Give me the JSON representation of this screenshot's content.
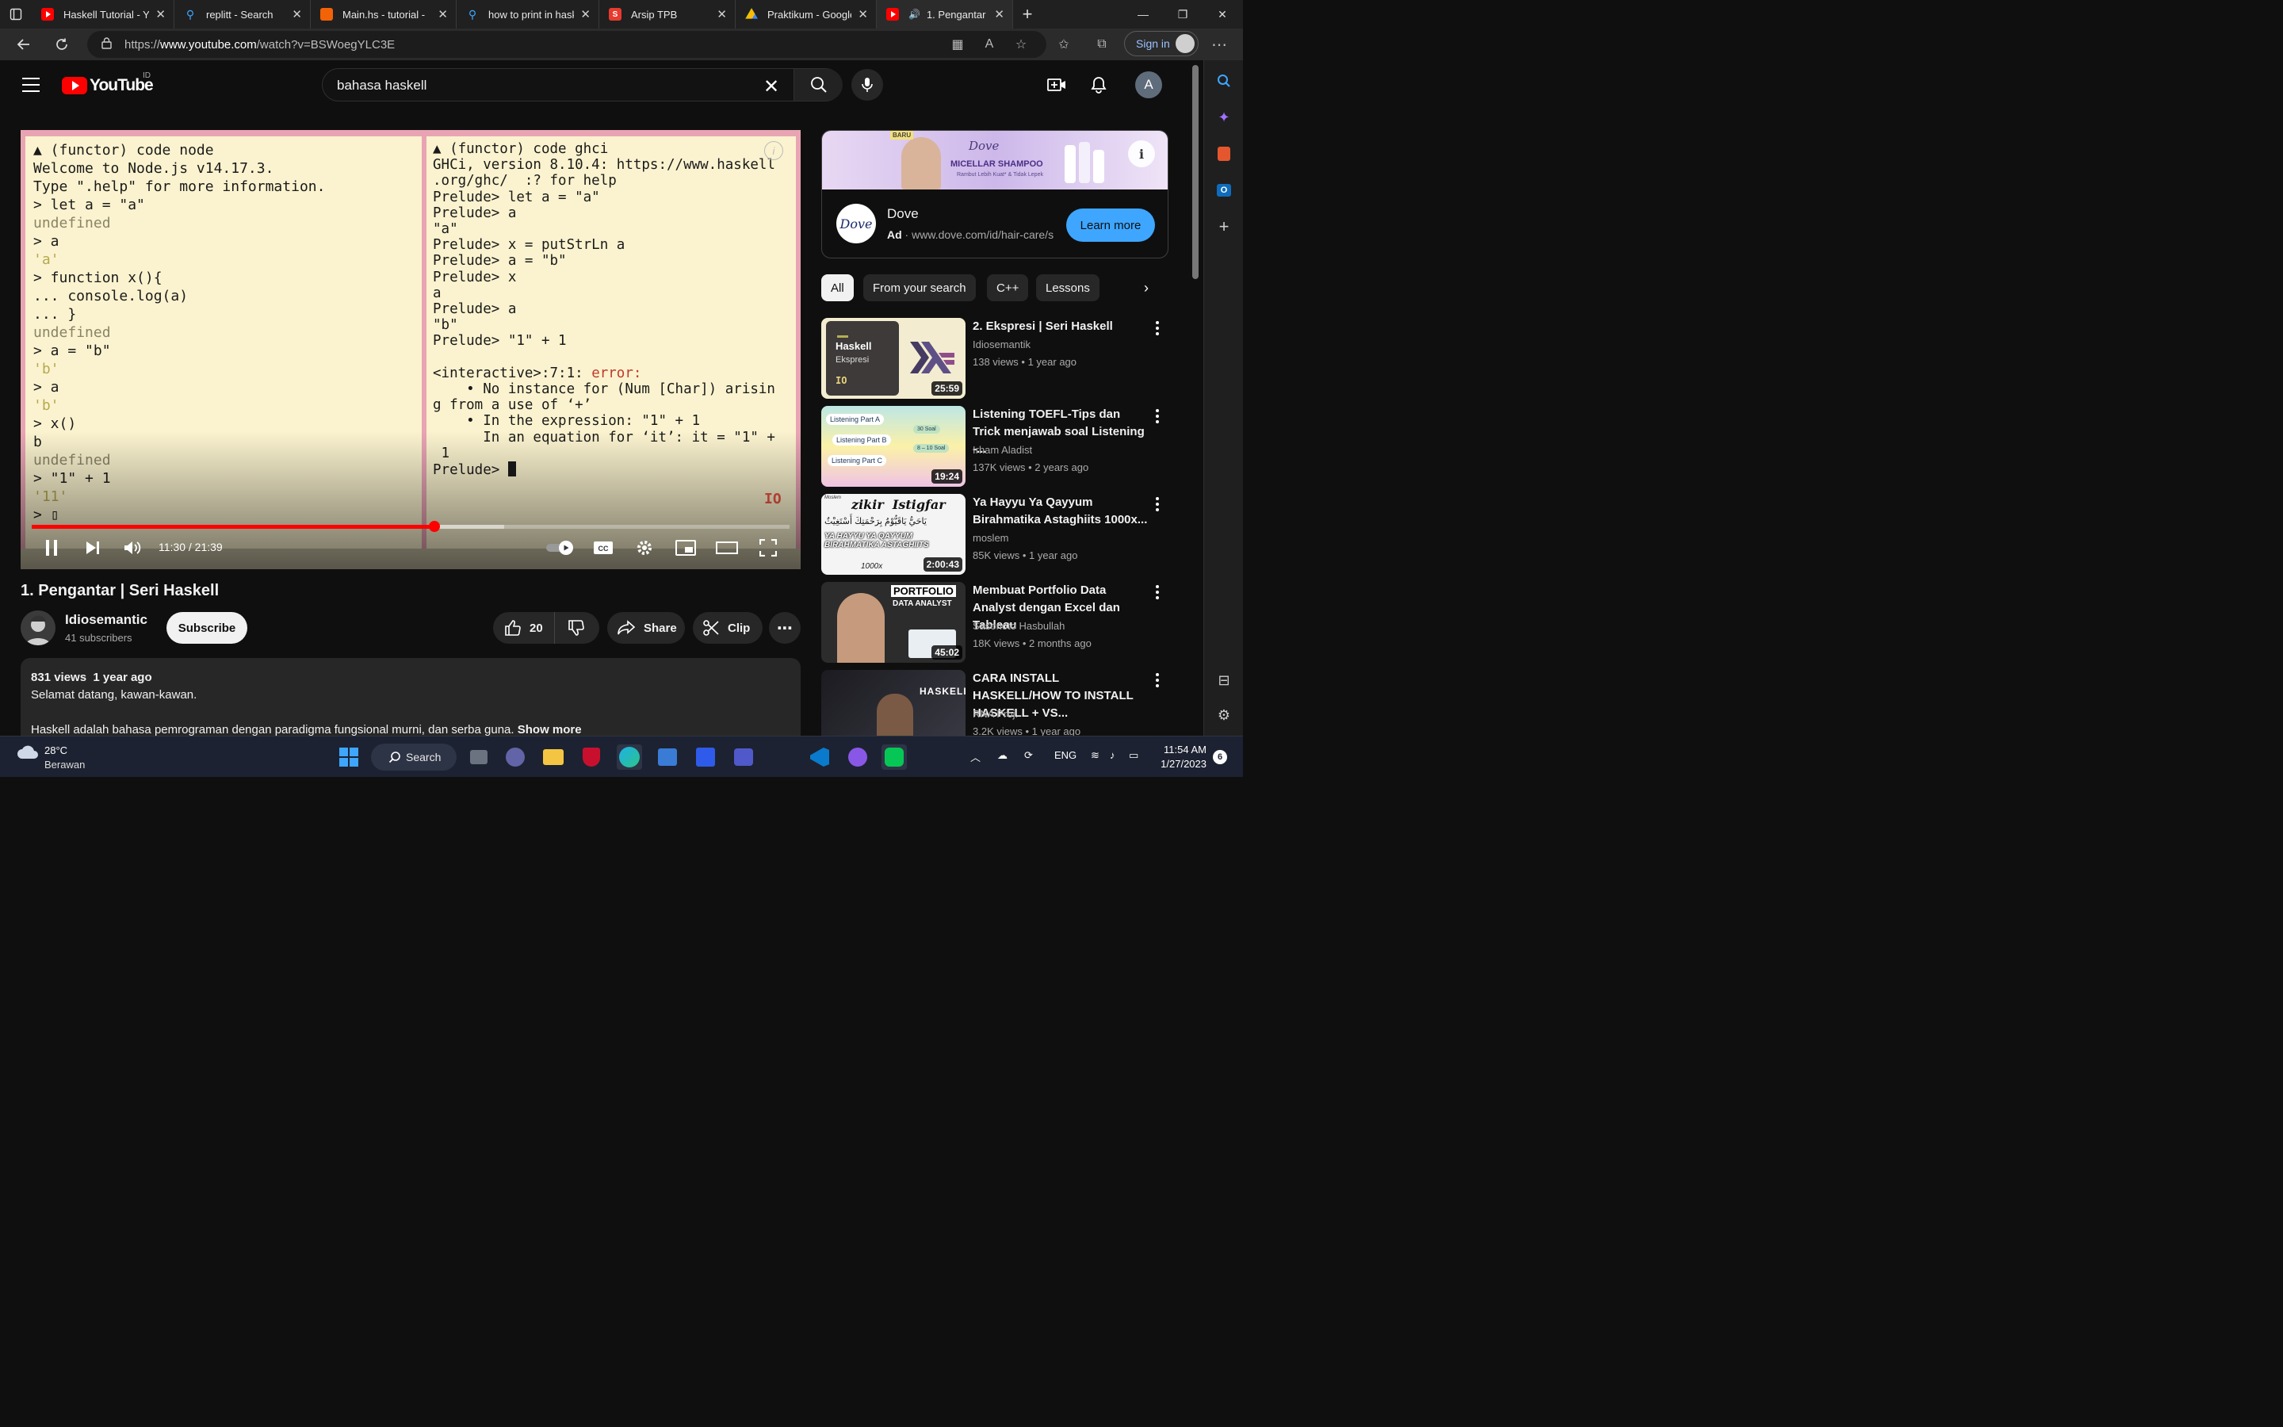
{
  "browser": {
    "tabs": [
      {
        "title": "Haskell Tutorial - Yo",
        "favicon": "youtube-icon",
        "color": "#ff0000"
      },
      {
        "title": "replitt - Search",
        "favicon": "search-icon",
        "color": "#3ea6ff"
      },
      {
        "title": "Main.hs - tutorial - ",
        "favicon": "replit-icon",
        "color": "#f26207"
      },
      {
        "title": "how to print in hask",
        "favicon": "search-icon",
        "color": "#3ea6ff"
      },
      {
        "title": "Arsip TPB",
        "favicon": "s-icon",
        "color": "#e63b2e"
      },
      {
        "title": "Praktikum - Google ",
        "favicon": "google-drive-icon",
        "color": "#fbbc04"
      },
      {
        "title": "1. Pengantar | ",
        "favicon": "youtube-icon",
        "color": "#ff0000",
        "active": true
      }
    ],
    "url_prefix": "https://",
    "url_host": "www.youtube.com",
    "url_path": "/watch?v=BSWoegYLC3E",
    "sign_in": "Sign in"
  },
  "youtube": {
    "logo_text": "YouTube",
    "country": "ID",
    "search_query": "bahasa haskell",
    "account_initial": "A"
  },
  "player": {
    "left_pane_lines": [
      {
        "t": "▲ (functor) code node",
        "c": ""
      },
      {
        "t": "Welcome to Node.js v14.17.3.",
        "c": ""
      },
      {
        "t": "Type \".help\" for more information.",
        "c": ""
      },
      {
        "t": "> let a = \"a\"",
        "c": ""
      },
      {
        "t": "undefined",
        "c": "dim"
      },
      {
        "t": "> a",
        "c": ""
      },
      {
        "t": "'a'",
        "c": "str"
      },
      {
        "t": "> function x(){",
        "c": ""
      },
      {
        "t": "... console.log(a)",
        "c": ""
      },
      {
        "t": "... }",
        "c": ""
      },
      {
        "t": "undefined",
        "c": "dim"
      },
      {
        "t": "> a = \"b\"",
        "c": ""
      },
      {
        "t": "'b'",
        "c": "str"
      },
      {
        "t": "> a",
        "c": ""
      },
      {
        "t": "'b'",
        "c": "str"
      },
      {
        "t": "> x()",
        "c": ""
      },
      {
        "t": "b",
        "c": ""
      },
      {
        "t": "undefined",
        "c": "dim"
      },
      {
        "t": "> \"1\" + 1",
        "c": ""
      },
      {
        "t": "'11'",
        "c": "str"
      },
      {
        "t": "> ▯",
        "c": ""
      }
    ],
    "right_pane_lines": [
      {
        "t": "▲ (functor) code ghci",
        "c": ""
      },
      {
        "t": "GHCi, version 8.10.4: https://www.haskell",
        "c": ""
      },
      {
        "t": ".org/ghc/  :? for help",
        "c": ""
      },
      {
        "t": "Prelude> let a = \"a\"",
        "c": ""
      },
      {
        "t": "Prelude> a",
        "c": ""
      },
      {
        "t": "\"a\"",
        "c": ""
      },
      {
        "t": "Prelude> x = putStrLn a",
        "c": ""
      },
      {
        "t": "Prelude> a = \"b\"",
        "c": ""
      },
      {
        "t": "Prelude> x",
        "c": ""
      },
      {
        "t": "a",
        "c": ""
      },
      {
        "t": "Prelude> a",
        "c": ""
      },
      {
        "t": "\"b\"",
        "c": ""
      },
      {
        "t": "Prelude> \"1\" + 1",
        "c": ""
      },
      {
        "t": "",
        "c": ""
      },
      {
        "t": "<interactive>:7:1: ",
        "c": "",
        "err": "error:"
      },
      {
        "t": "    • No instance for (Num [Char]) arisin",
        "c": ""
      },
      {
        "t": "g from a use of ‘+’",
        "c": ""
      },
      {
        "t": "    • In the expression: \"1\" + 1",
        "c": ""
      },
      {
        "t": "      In an equation for ‘it’: it = \"1\" +",
        "c": ""
      },
      {
        "t": " 1",
        "c": ""
      },
      {
        "t": "Prelude> ",
        "c": "",
        "cursor": true
      }
    ],
    "badge": "IO",
    "time_current": "11:30",
    "time_total": "21:39",
    "time_display": "11:30 / 21:39",
    "played_fraction": 0.531,
    "buffered_fraction": 0.623
  },
  "video": {
    "title": "1. Pengantar | Seri Haskell",
    "channel": "Idiosemantic",
    "subscribers": "41 subscribers",
    "subscribe_label": "Subscribe",
    "likes": "20",
    "share_label": "Share",
    "clip_label": "Clip",
    "views": "831 views",
    "age": "1 year ago",
    "desc_line1": "Selamat datang, kawan-kawan.",
    "desc_line2": "Haskell adalah bahasa pemrograman dengan paradigma fungsional murni, dan serba guna.",
    "show_more": "Show more"
  },
  "ad": {
    "banner_badge": "BARU",
    "banner_brand": "Dove",
    "banner_product": "MICELLAR SHAMPOO",
    "banner_tagline": "Rambut Lebih Kuat* & Tidak Lepek",
    "logo": "Dove",
    "name": "Dove",
    "label": "Ad",
    "url": "www.dove.com/id/hair-care/sha",
    "cta": "Learn more"
  },
  "chips": [
    "All",
    "From your search",
    "C++",
    "Lessons"
  ],
  "recommendations": [
    {
      "title": "2. Ekspresi | Seri Haskell",
      "channel": "Idiosemantik",
      "meta": "138 views • 1 year ago",
      "duration": "25:59",
      "thumb_title": "Haskell",
      "thumb_sub": "Ekspresi",
      "thumb_badge": "IO"
    },
    {
      "title": "Listening TOEFL-Tips dan Trick menjawab soal Listening -...",
      "channel": "Irham Aladist",
      "meta": "137K views • 2 years ago",
      "duration": "19:24",
      "thumb_labels": [
        "Listening Part A",
        "Listening Part B",
        "Listening Part C",
        "30 Soal",
        "8 – 10 Soal"
      ]
    },
    {
      "title": "Ya Hayyu Ya Qayyum Birahmatika Astaghiits 1000x...",
      "channel": "moslem",
      "meta": "85K views • 1 year ago",
      "duration": "2:00:43",
      "thumb_title": "zikir  Istigfar",
      "thumb_sub": "YA HAYYU YA QAYYUM BIRAHMATIKA ASTAGHIITS",
      "thumb_count": "1000x",
      "thumb_arabic": "يَاحَيُّ يَاقَيُّوْمُ بِرَحْمَتِكَ أَسْتَغِيْثُ",
      "thumb_brand": "Moslem"
    },
    {
      "title": "Membuat Portfolio Data Analyst dengan Excel dan Tableau",
      "channel": "Sasonoto Hasbullah",
      "meta": "18K views • 2 months ago",
      "duration": "45:02",
      "thumb_title": "PORTFOLIO",
      "thumb_sub": "DATA ANALYST"
    },
    {
      "title": "CARA INSTALL HASKELL/HOW TO INSTALL HASKELL + VS...",
      "channel": "RNA Proj.",
      "meta": "3.2K views • 1 year ago",
      "duration": "",
      "thumb_title": "HASKELL"
    }
  ],
  "taskbar": {
    "temperature": "28°C",
    "condition": "Berawan",
    "search_label": "Search",
    "lang": "ENG",
    "time": "11:54 AM",
    "date": "1/27/2023",
    "notifications": "6"
  }
}
